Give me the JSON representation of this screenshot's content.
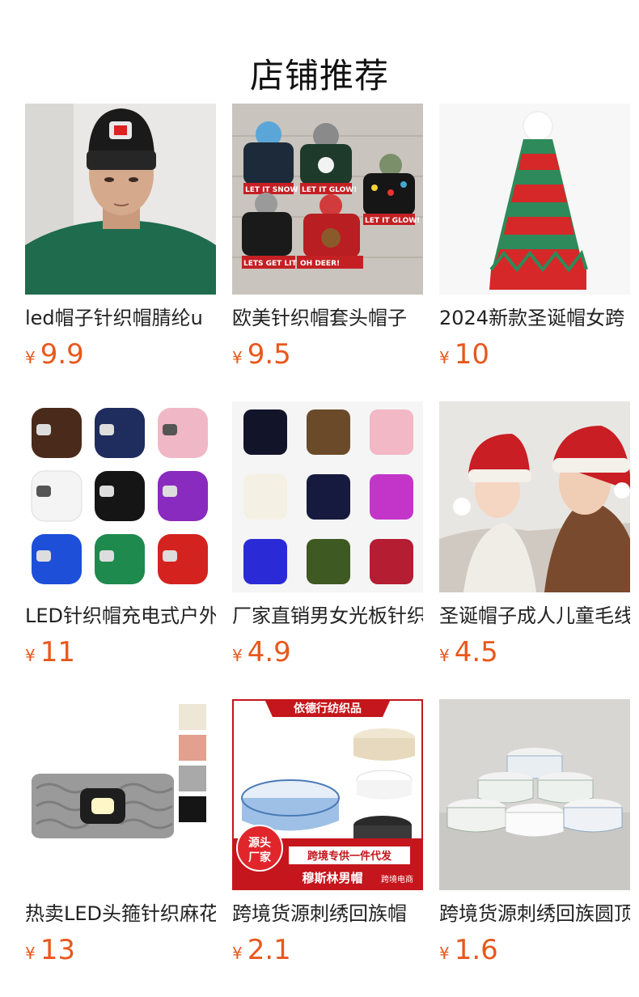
{
  "section": {
    "title": "店铺推荐"
  },
  "currency_symbol": "¥",
  "products": [
    {
      "name": "led帽子针织帽腈纶u",
      "price": "9.9",
      "image": "man-black-led-beanie"
    },
    {
      "name": "欧美针织帽套头帽子",
      "price": "9.5",
      "image": "christmas-light-up-beanies",
      "image_text": [
        "LET IT SNOW",
        "LET IT GLOW!",
        "LET IT GLOW!",
        "LETS GET LIT",
        "OH DEER!"
      ]
    },
    {
      "name": "2024新款圣诞帽女跨",
      "price": "10",
      "image": "elf-striped-hat"
    },
    {
      "name": "LED针织帽充电式户外",
      "price": "11",
      "image": "led-beanie-color-grid"
    },
    {
      "name": "厂家直销男女光板针织",
      "price": "4.9",
      "image": "plain-beanie-color-grid"
    },
    {
      "name": "圣诞帽子成人儿童毛线",
      "price": "4.5",
      "image": "mother-child-santa-hats"
    },
    {
      "name": "热卖LED头箍针织麻花",
      "price": "13",
      "image": "led-knit-headband"
    },
    {
      "name": "跨境货源刺绣回族帽",
      "price": "2.1",
      "image": "muslim-prayer-caps-ad",
      "image_text": [
        "依德行纺织品",
        "源头",
        "厂家",
        "跨境专供一件代发",
        "穆斯林男帽",
        "跨境电商"
      ]
    },
    {
      "name": "跨境货源刺绣回族圆顶",
      "price": "1.6",
      "image": "stacked-prayer-caps"
    }
  ]
}
